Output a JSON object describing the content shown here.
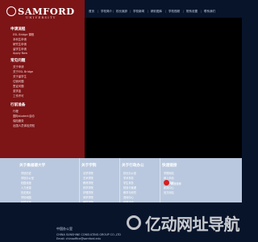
{
  "brand": {
    "name": "SAMFORD",
    "subtitle": "UNIVERSITY"
  },
  "topnav": {
    "items": [
      "首页",
      "学校简介",
      "校长致辞",
      "学校新闻",
      "精彩图库",
      "学校视频",
      "院系设置",
      "联系我们"
    ]
  },
  "sidebar": {
    "sections": [
      {
        "title": "申请流程",
        "items": [
          "ESL Bridge 课程",
          "本科生申请",
          "研究生申请",
          "留学生申请",
          "Apply Now"
        ]
      },
      {
        "title": "常见问题",
        "items": [
          "关于申请",
          "关于ESL Bridge",
          "关于留学生",
          "住宿问题",
          "签证问题",
          "奖学金",
          "工作许可"
        ]
      },
      {
        "title": "行前准备",
        "items": [
          "行程",
          "国际student活动",
          "保险服务",
          "出国人员体检须知"
        ]
      }
    ]
  },
  "lower": {
    "columns": [
      {
        "title": "关于桑福德大学",
        "items": [
          "学校历史",
          "学校办公室",
          "校园设施",
          "人力资源",
          "历史照片",
          "学校地图",
          "校园开放"
        ]
      },
      {
        "title": "关于学院",
        "items": [
          "法学学院",
          "艺术学院",
          "教育学院",
          "药学学院",
          "护理学院",
          "商学学院",
          "神学学院"
        ]
      },
      {
        "title": "关于行政办公",
        "items": [
          "校长办公室",
          "学术事务",
          "学生事务",
          "财务与管理",
          "教学与研究",
          "咨询中心",
          "体育活动"
        ]
      },
      {
        "title": "快速链接",
        "items": [
          "学院网站",
          "网上申请",
          "网上捐款",
          "新闻中心",
          "官方网站"
        ],
        "weibo_label": "新浪微博"
      }
    ]
  },
  "footer": {
    "line1": "中国办公室",
    "line2": "CHINA SUNSHINE CONSULTING GROUP CO.,LTD",
    "line3": "Email: chinaoffice@samford.edu"
  },
  "watermark": {
    "text": "亿动网址导航"
  }
}
